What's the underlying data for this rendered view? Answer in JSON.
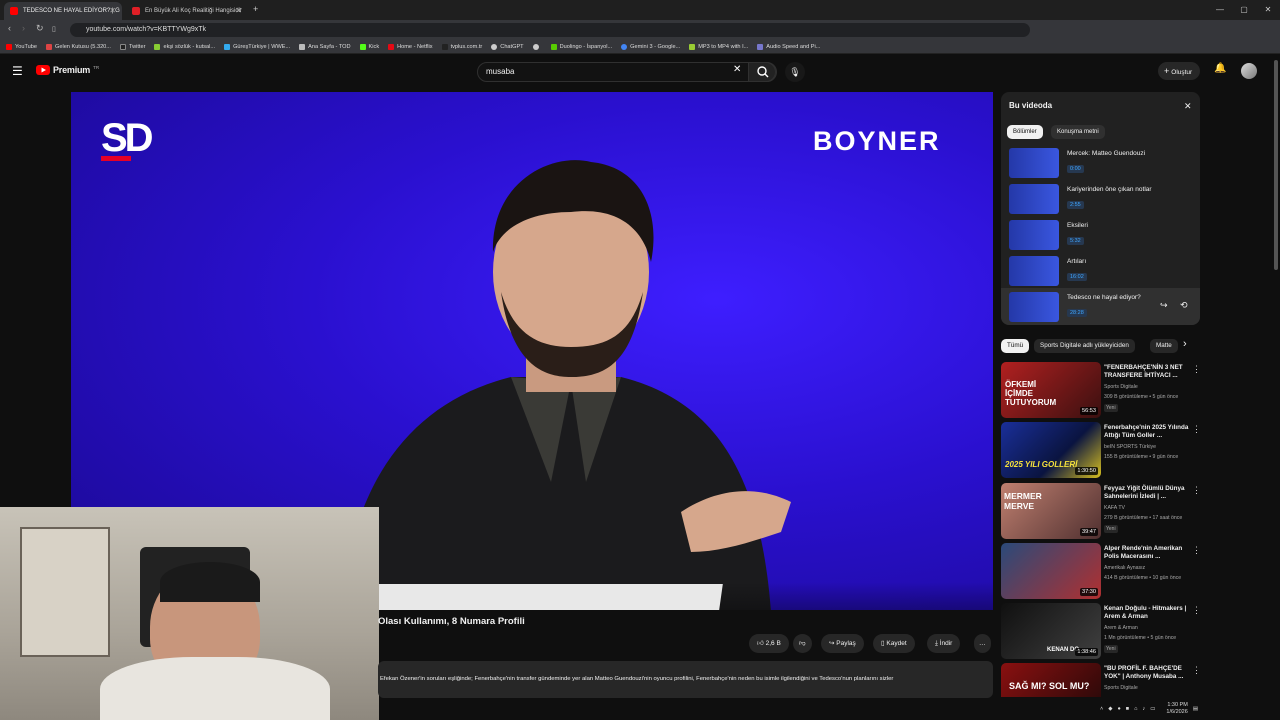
{
  "browser": {
    "tabs": [
      {
        "label": "TEDESCO NE HAYAL EDİYOR? | G",
        "active": true,
        "favicon_color": "#ff0000"
      },
      {
        "label": "En Büyük Ali Koç Realitiği Hangisidir",
        "active": false,
        "favicon_color": "#e01f26"
      }
    ],
    "new_tab": "+",
    "url": "youtube.com/watch?v=KBTTYWg9xTk",
    "bookmarks": [
      "YouTube",
      "Gelen Kutusu (5.320...",
      "Twitter",
      "ekşi sözlük - kutsal...",
      "GüreşTürkiye | WWE...",
      "Ana Sayfa - TOD",
      "Kick",
      "Home - Netflix",
      "tvplus.com.tr",
      "ChatGPT",
      "",
      "Duolingo - İspanyol...",
      "Gemini 3 - Google...",
      "MP3 to MP4 with I...",
      "Audio Speed and Pi..."
    ],
    "window_controls": [
      "—",
      "▢",
      "✕"
    ]
  },
  "youtube": {
    "logo": "Premium",
    "logo_sup": "TR",
    "search_value": "musaba",
    "create_label": "Oluştur"
  },
  "video": {
    "brand_left": "SD",
    "brand_right": "BOYNER",
    "title": "Olası Kullanımı, 8 Numara Profili",
    "description": "Efekan Özener'in soruları eşliğinde; Fenerbahçe'nin transfer gündeminde yer alan Matteo Guendouzi'nin oyuncu profilini, Fenerbahçe'nin neden bu isimle ilgilendiğini ve Tedesco'nun planlarını sizler",
    "actions": {
      "likes": "2,6 B",
      "share": "Paylaş",
      "save": "Kaydet",
      "download": "İndir",
      "more": "…"
    }
  },
  "panel": {
    "title": "Bu videoda",
    "tabs": [
      "Bölümler",
      "Konuşma metni"
    ],
    "chapters": [
      {
        "title": "Mercek: Matteo Guendouzi",
        "time": "0:00"
      },
      {
        "title": "Kariyerinden öne çıkan notlar",
        "time": "2:55"
      },
      {
        "title": "Eksileri",
        "time": "5:32"
      },
      {
        "title": "Artıları",
        "time": "16:02"
      },
      {
        "title": "Tedesco ne hayal ediyor?",
        "time": "28:28"
      }
    ]
  },
  "filters": [
    "Tümü",
    "Sports Digitale adlı yükleyiciden",
    "Matte"
  ],
  "recommendations": [
    {
      "title": "\"FENERBAHÇE'NİN 3 NET TRANSFERE İHTİYACI ...",
      "channel": "Sports Digitale",
      "meta": "309 B görüntüleme • 5 gün önce",
      "badge": "Yeni",
      "duration": "56:53",
      "colors": [
        "#b12020",
        "#3a1010"
      ],
      "thumb_text": "ÖFKEMİ İÇİMDE TUTUYORUM"
    },
    {
      "title": "Fenerbahçe'nin 2025 Yılında Attığı Tüm Goller ...",
      "channel": "beIN SPORTS Türkiye",
      "meta": "155 B görüntüleme • 9 gün önce",
      "badge": "",
      "duration": "1:30:50",
      "colors": [
        "#1a2f9a",
        "#d8c020"
      ],
      "thumb_text": "2025 YILI GOLLERİ"
    },
    {
      "title": "Feyyaz Yiğit Ölümlü Dünya Sahnelerini İzledi | ...",
      "channel": "KAFA TV",
      "meta": "279 B görüntüleme • 17 saat önce",
      "badge": "Yeni",
      "duration": "39:47",
      "colors": [
        "#c08070",
        "#503030"
      ],
      "thumb_text": "MERMER MERVE"
    },
    {
      "title": "Alper Rende'nin Amerikan Polis Macerasını ...",
      "channel": "Amerikalı Aynasız",
      "meta": "414 B görüntüleme • 10 gün önce",
      "badge": "",
      "duration": "37:30",
      "colors": [
        "#2a4a7a",
        "#b03030"
      ],
      "thumb_text": ""
    },
    {
      "title": "Kenan Doğulu - Hitmakers | Arem & Arman",
      "channel": "Arem & Arman",
      "meta": "1 Mn görüntüleme • 5 gün önce",
      "badge": "Yeni",
      "duration": "1:38:46",
      "colors": [
        "#101010",
        "#404040"
      ],
      "thumb_text": "KENAN DO"
    },
    {
      "title": "\"BU PROFİL F. BAHÇE'DE YOK\" | Anthony Musaba ...",
      "channel": "Sports Digitale",
      "meta": "",
      "badge": "",
      "duration": "",
      "colors": [
        "#8a1010",
        "#200808"
      ],
      "thumb_text": "SAĞ MI? SOL MU?"
    }
  ],
  "taskbar": {
    "time": "1:30 PM",
    "date": "1/6/2026"
  }
}
